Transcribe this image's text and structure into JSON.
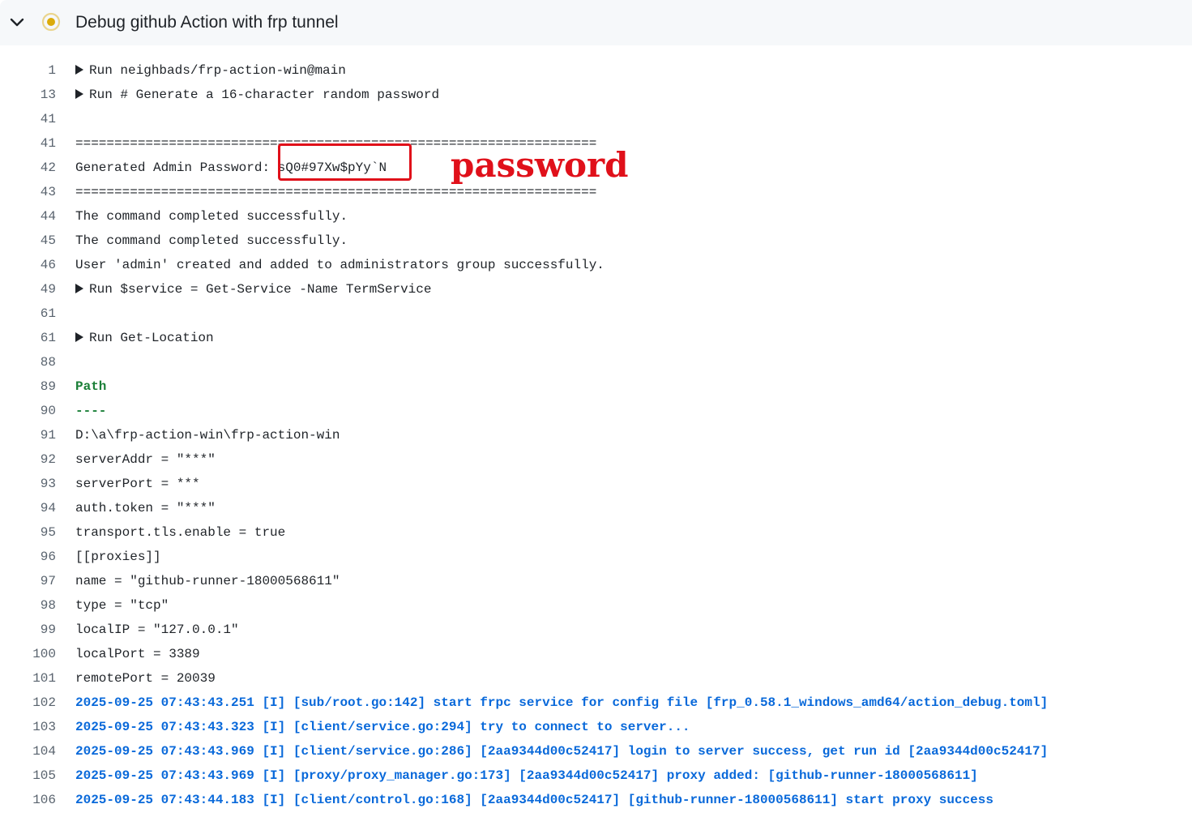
{
  "header": {
    "title": "Debug github Action with frp tunnel",
    "status": "in-progress",
    "status_color": "#dbab0a",
    "expand_icon": "chevron-down-icon"
  },
  "annotation": {
    "label": "password",
    "color": "#e0101a"
  },
  "log": {
    "lines": [
      {
        "num": "1",
        "text": "Run neighbads/frp-action-win@main",
        "style": "group"
      },
      {
        "num": "13",
        "text": "Run # Generate a 16-character random password",
        "style": "group"
      },
      {
        "num": "41",
        "text": "",
        "style": "normal"
      },
      {
        "num": "41",
        "text": "===================================================================",
        "style": "normal"
      },
      {
        "num": "42",
        "text": "Generated Admin Password: sQ0#97Xw$pYy`N",
        "style": "normal"
      },
      {
        "num": "43",
        "text": "===================================================================",
        "style": "normal"
      },
      {
        "num": "44",
        "text": "The command completed successfully.",
        "style": "normal"
      },
      {
        "num": "45",
        "text": "The command completed successfully.",
        "style": "normal"
      },
      {
        "num": "46",
        "text": "User 'admin' created and added to administrators group successfully.",
        "style": "normal"
      },
      {
        "num": "49",
        "text": "Run $service = Get-Service -Name TermService",
        "style": "group"
      },
      {
        "num": "61",
        "text": "",
        "style": "normal"
      },
      {
        "num": "61",
        "text": "Run Get-Location",
        "style": "group"
      },
      {
        "num": "88",
        "text": "",
        "style": "normal"
      },
      {
        "num": "89",
        "text": "Path",
        "style": "green"
      },
      {
        "num": "90",
        "text": "----",
        "style": "green"
      },
      {
        "num": "91",
        "text": "D:\\a\\frp-action-win\\frp-action-win",
        "style": "normal"
      },
      {
        "num": "92",
        "text": "serverAddr = \"***\"",
        "style": "normal"
      },
      {
        "num": "93",
        "text": "serverPort = ***",
        "style": "normal"
      },
      {
        "num": "94",
        "text": "auth.token = \"***\"",
        "style": "normal"
      },
      {
        "num": "95",
        "text": "transport.tls.enable = true",
        "style": "normal"
      },
      {
        "num": "96",
        "text": "[[proxies]]",
        "style": "normal"
      },
      {
        "num": "97",
        "text": "name = \"github-runner-18000568611\"",
        "style": "normal"
      },
      {
        "num": "98",
        "text": "type = \"tcp\"",
        "style": "normal"
      },
      {
        "num": "99",
        "text": "localIP = \"127.0.0.1\"",
        "style": "normal"
      },
      {
        "num": "100",
        "text": "localPort = 3389",
        "style": "normal"
      },
      {
        "num": "101",
        "text": "remotePort = 20039",
        "style": "normal"
      },
      {
        "num": "102",
        "text": "2025-09-25 07:43:43.251 [I] [sub/root.go:142] start frpc service for config file [frp_0.58.1_windows_amd64/action_debug.toml]",
        "style": "blue"
      },
      {
        "num": "103",
        "text": "2025-09-25 07:43:43.323 [I] [client/service.go:294] try to connect to server...",
        "style": "blue"
      },
      {
        "num": "104",
        "text": "2025-09-25 07:43:43.969 [I] [client/service.go:286] [2aa9344d00c52417] login to server success, get run id [2aa9344d00c52417]",
        "style": "blue"
      },
      {
        "num": "105",
        "text": "2025-09-25 07:43:43.969 [I] [proxy/proxy_manager.go:173] [2aa9344d00c52417] proxy added: [github-runner-18000568611]",
        "style": "blue"
      },
      {
        "num": "106",
        "text": "2025-09-25 07:43:44.183 [I] [client/control.go:168] [2aa9344d00c52417] [github-runner-18000568611] start proxy success",
        "style": "blue"
      }
    ]
  }
}
